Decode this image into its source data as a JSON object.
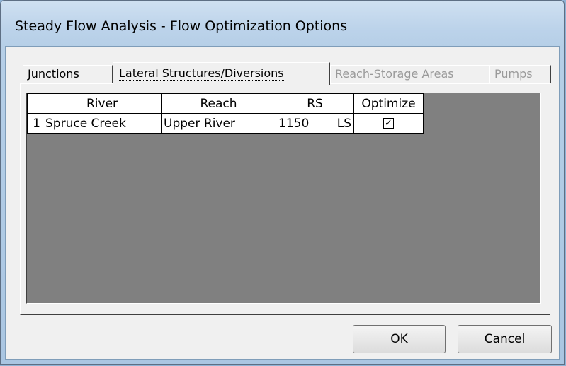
{
  "window": {
    "title": "Steady Flow Analysis - Flow Optimization Options"
  },
  "tabs": [
    {
      "label": "Junctions",
      "state": "normal"
    },
    {
      "label": "Lateral Structures/Diversions",
      "state": "active"
    },
    {
      "label": "Reach-Storage Areas",
      "state": "disabled"
    },
    {
      "label": "Pumps",
      "state": "disabled"
    }
  ],
  "grid": {
    "columns": [
      "",
      "River",
      "Reach",
      "RS",
      "Optimize"
    ],
    "rows": [
      {
        "num": "1",
        "river": "Spruce Creek",
        "reach": "Upper River",
        "rs": "1150",
        "rs_type": "LS",
        "optimize": "✓"
      }
    ]
  },
  "buttons": {
    "ok": "OK",
    "cancel": "Cancel"
  },
  "colors": {
    "title_bar": "#bcd3ea",
    "client": "#f0f0f0",
    "grid_background": "#808080",
    "disabled_text": "#9a9a9a"
  }
}
